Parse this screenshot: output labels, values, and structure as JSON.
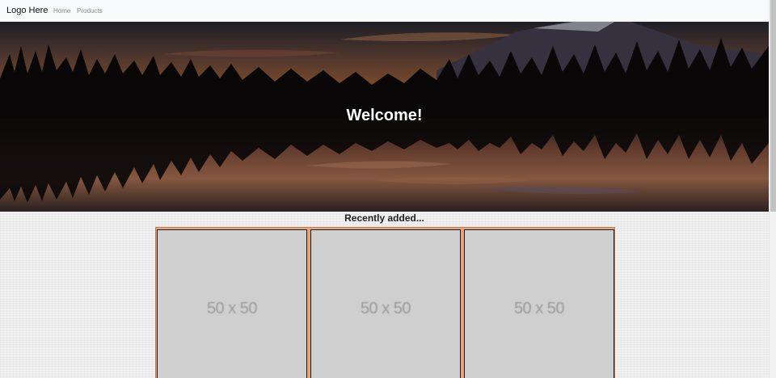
{
  "navbar": {
    "brand": "Logo Here",
    "links": [
      "Home",
      "Products"
    ]
  },
  "hero": {
    "title": "Welcome!"
  },
  "recent": {
    "title": "Recently added...",
    "items": [
      {
        "placeholder": "50 x 50"
      },
      {
        "placeholder": "50 x 50"
      },
      {
        "placeholder": "50 x 50"
      }
    ]
  },
  "colors": {
    "navbar_bg": "#f8f9fa",
    "card_frame": "#e8a27a",
    "card_bg": "#cfcfcf"
  }
}
